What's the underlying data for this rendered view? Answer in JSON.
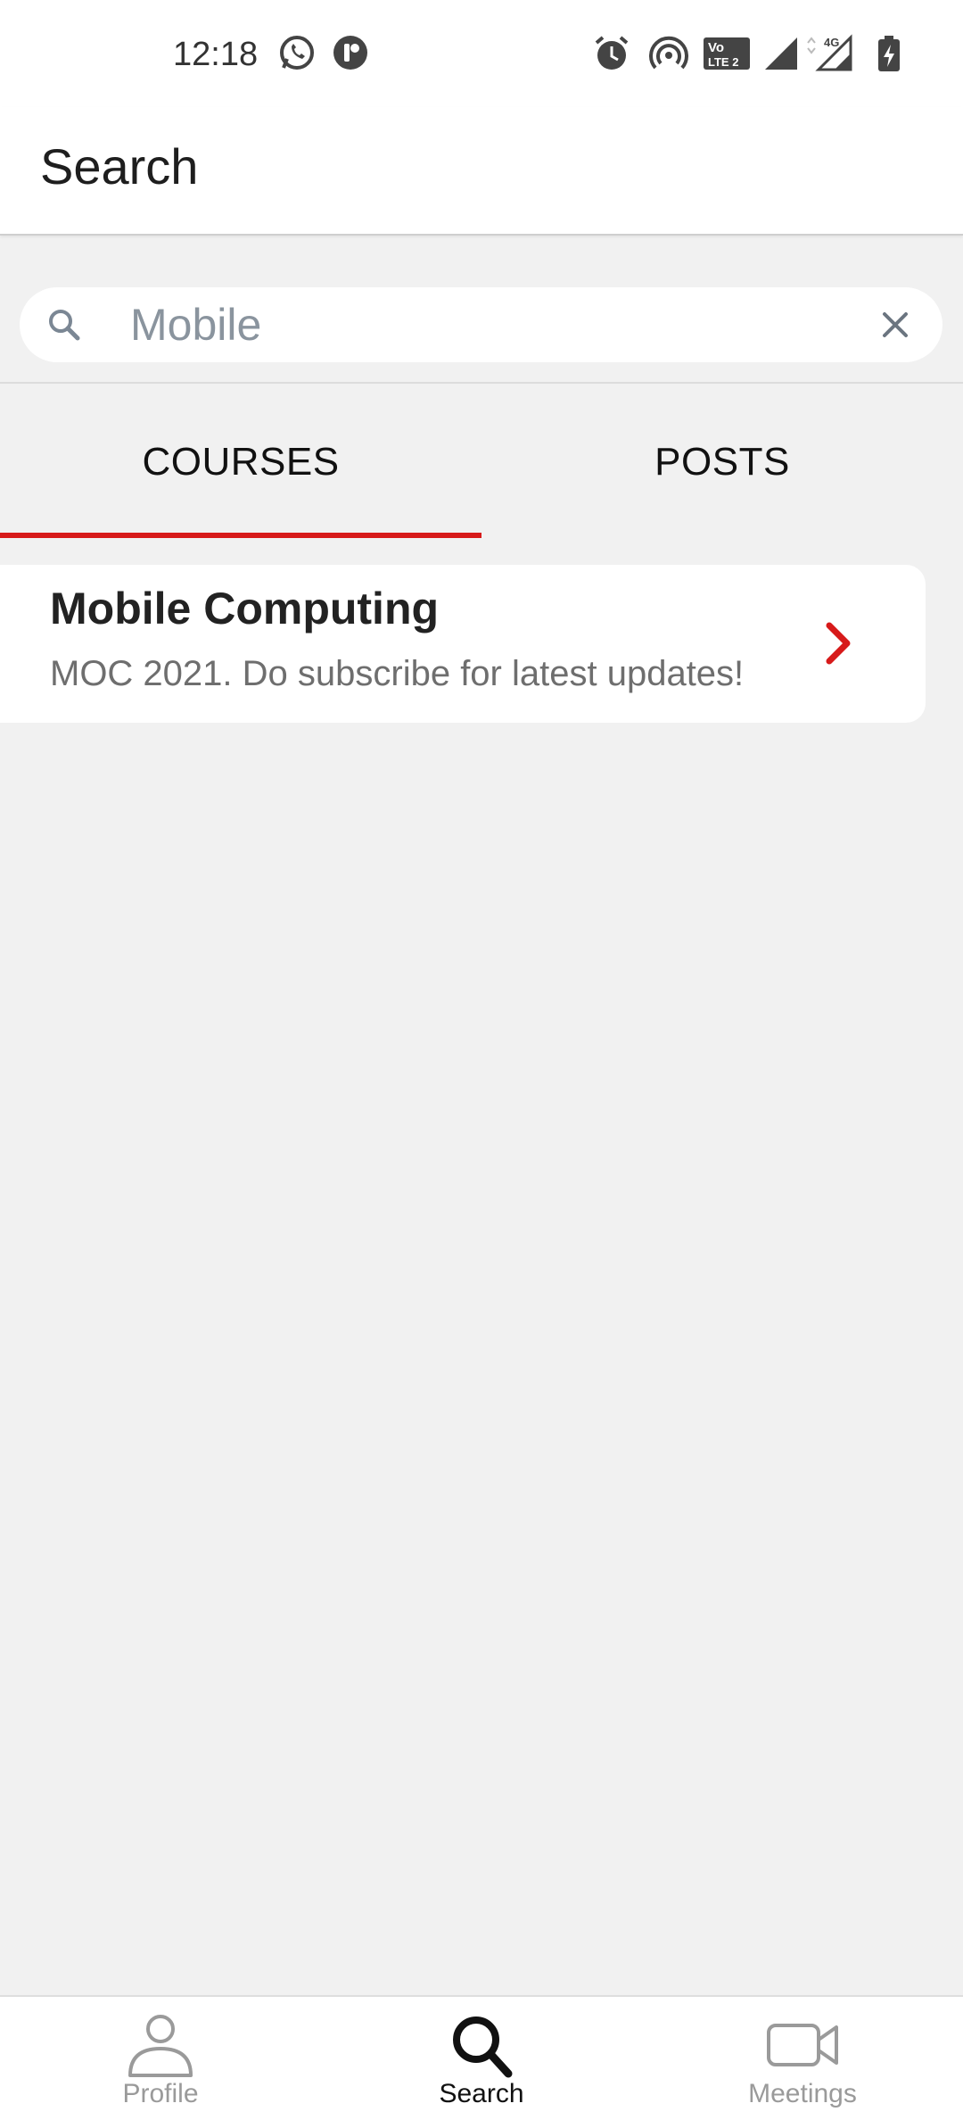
{
  "status_bar": {
    "time": "12:18",
    "left_icons": [
      "whatsapp-icon",
      "app-notification-icon"
    ],
    "right_icons": [
      "alarm-icon",
      "hotspot-icon",
      "volte-icon",
      "signal-icon",
      "4g-signal-icon",
      "battery-charging-icon"
    ],
    "network_label": "4G",
    "volte_label_1": "Vo",
    "volte_label_2": "LTE 2"
  },
  "app_bar": {
    "title": "Search"
  },
  "search": {
    "value": "Mobile",
    "placeholder": "",
    "search_icon": "search-icon",
    "clear_icon": "close-icon"
  },
  "tabs": [
    {
      "label": "COURSES",
      "active": true
    },
    {
      "label": "POSTS",
      "active": false
    }
  ],
  "results": [
    {
      "title": "Mobile Computing",
      "description": "MOC 2021. Do subscribe for latest updates!",
      "icon": "chevron-right-icon"
    }
  ],
  "bottom_nav": [
    {
      "label": "Profile",
      "icon": "person-icon",
      "active": false
    },
    {
      "label": "Search",
      "icon": "search-icon",
      "active": true
    },
    {
      "label": "Meetings",
      "icon": "video-camera-icon",
      "active": false
    }
  ],
  "colors": {
    "accent": "#d71a1a",
    "background": "#f1f1f1",
    "surface": "#ffffff"
  }
}
